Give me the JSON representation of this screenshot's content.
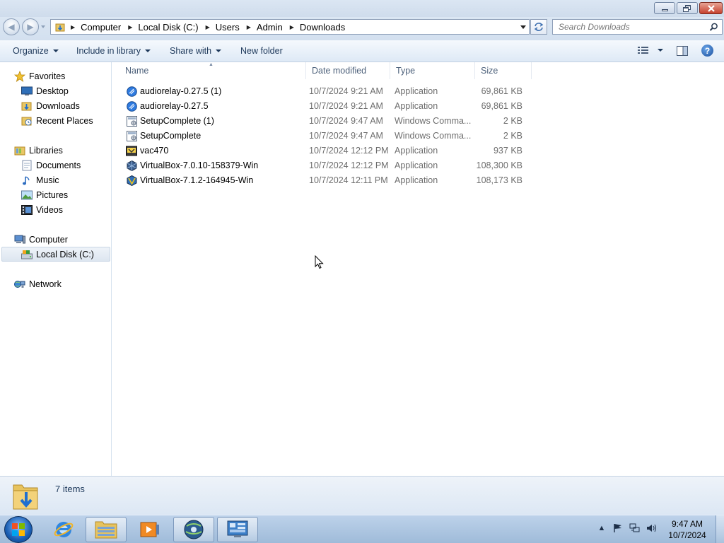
{
  "window": {
    "minimize_icon": "minimize-icon",
    "maximize_icon": "maximize-icon",
    "close_icon": "close-icon"
  },
  "address": {
    "segments": [
      "Computer",
      "Local Disk (C:)",
      "Users",
      "Admin",
      "Downloads"
    ]
  },
  "search": {
    "placeholder": "Search Downloads"
  },
  "toolbar": {
    "organize": "Organize",
    "include": "Include in library",
    "share": "Share with",
    "new_folder": "New folder"
  },
  "nav": {
    "favorites": "Favorites",
    "desktop": "Desktop",
    "downloads": "Downloads",
    "recent": "Recent Places",
    "libraries": "Libraries",
    "documents": "Documents",
    "music": "Music",
    "pictures": "Pictures",
    "videos": "Videos",
    "computer": "Computer",
    "local_disk": "Local Disk (C:)",
    "network": "Network"
  },
  "columns": {
    "name": "Name",
    "date": "Date modified",
    "type": "Type",
    "size": "Size"
  },
  "files": [
    {
      "name": "audiorelay-0.27.5 (1)",
      "date": "10/7/2024 9:21 AM",
      "type": "Application",
      "size": "69,861 KB",
      "icon": "audiorelay-icon"
    },
    {
      "name": "audiorelay-0.27.5",
      "date": "10/7/2024 9:21 AM",
      "type": "Application",
      "size": "69,861 KB",
      "icon": "audiorelay-icon"
    },
    {
      "name": "SetupComplete (1)",
      "date": "10/7/2024 9:47 AM",
      "type": "Windows Comma...",
      "size": "2 KB",
      "icon": "batch-file-icon"
    },
    {
      "name": "SetupComplete",
      "date": "10/7/2024 9:47 AM",
      "type": "Windows Comma...",
      "size": "2 KB",
      "icon": "batch-file-icon"
    },
    {
      "name": "vac470",
      "date": "10/7/2024 12:12 PM",
      "type": "Application",
      "size": "937 KB",
      "icon": "installer-icon"
    },
    {
      "name": "VirtualBox-7.0.10-158379-Win",
      "date": "10/7/2024 12:12 PM",
      "type": "Application",
      "size": "108,300 KB",
      "icon": "virtualbox-icon"
    },
    {
      "name": "VirtualBox-7.1.2-164945-Win",
      "date": "10/7/2024 12:11 PM",
      "type": "Application",
      "size": "108,173 KB",
      "icon": "virtualbox-icon"
    }
  ],
  "status": {
    "count": "7 items"
  },
  "clock": {
    "time": "9:47 AM",
    "date": "10/7/2024"
  }
}
